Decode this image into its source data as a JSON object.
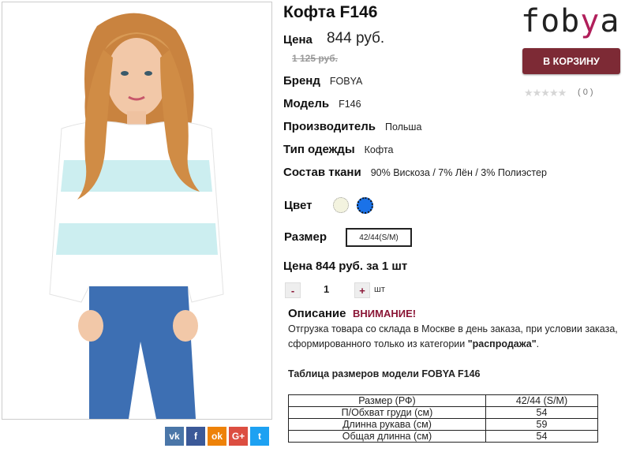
{
  "product": {
    "title": "Кофта F146",
    "price_label": "Цена",
    "price": "844 руб.",
    "old_price": "1 125 руб."
  },
  "attributes": [
    {
      "label": "Бренд",
      "value": "FOBYA"
    },
    {
      "label": "Модель",
      "value": "F146"
    },
    {
      "label": "Производитель",
      "value": "Польша"
    },
    {
      "label": "Тип одежды",
      "value": "Кофта"
    },
    {
      "label": "Состав ткани",
      "value": "90% Вискоза / 7% Лён / 3% Полиэстер"
    }
  ],
  "logo": {
    "before": "fob",
    "accent": "y",
    "after": "a",
    "accent_color": "#b01e5a"
  },
  "cart_button": "В КОРЗИНУ",
  "rating": {
    "stars": "★★★★★",
    "count": "( 0 )"
  },
  "color": {
    "label": "Цвет",
    "options": [
      {
        "name": "cream",
        "hex": "#f3f3df"
      },
      {
        "name": "blue",
        "hex": "#1a72e8"
      }
    ]
  },
  "size": {
    "label": "Размер",
    "selected": "42/44(S/M)"
  },
  "quantity": {
    "summary": "Цена 844 руб. за 1 шт",
    "minus": "-",
    "value": "1",
    "plus": "+",
    "unit": "шт"
  },
  "description": {
    "label": "Описание",
    "warning": "ВНИМАНИЕ!",
    "text_before": "Отгрузка товара со склада в Москве в день заказа, при условии заказа, сформированного только из категории ",
    "text_bold": "\"распродажа\"",
    "text_after": "."
  },
  "size_table": {
    "title": "Таблица размеров модели FOBYA F146",
    "header": [
      "Размер (РФ)",
      "42/44 (S/M)"
    ],
    "rows": [
      [
        "П/Обхват груди (см)",
        "54"
      ],
      [
        "Длинна рукава (см)",
        "59"
      ],
      [
        "Общая длинна (см)",
        "54"
      ]
    ]
  },
  "share": [
    {
      "name": "vk",
      "glyph": "vk",
      "color": "#4a76a8"
    },
    {
      "name": "facebook",
      "glyph": "f",
      "color": "#3b5998"
    },
    {
      "name": "odnoklassniki",
      "glyph": "ok",
      "color": "#ee8208"
    },
    {
      "name": "google-plus",
      "glyph": "G+",
      "color": "#dc4e41"
    },
    {
      "name": "twitter",
      "glyph": "t",
      "color": "#1da1f2"
    }
  ]
}
